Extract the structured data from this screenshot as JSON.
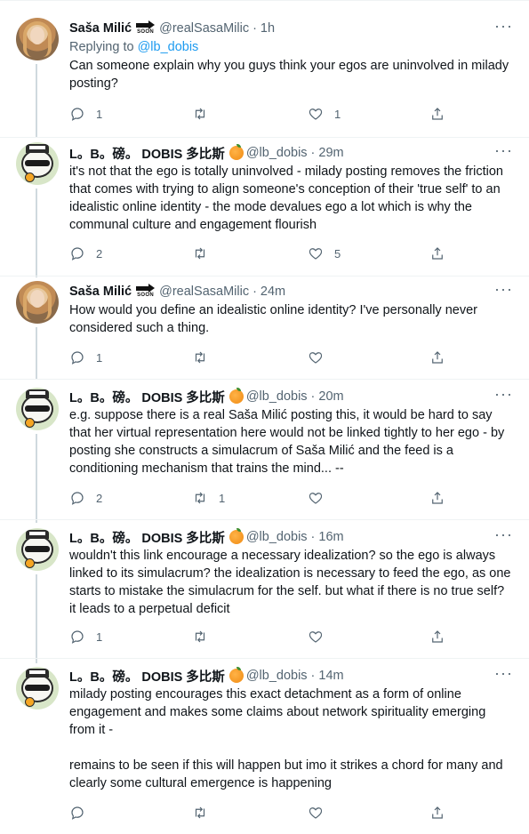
{
  "tweets": [
    {
      "name": "Saša Milić",
      "handle": "@realSasaMilic",
      "time": "1h",
      "badge": "SOON",
      "replying_prefix": "Replying to ",
      "replying_to": "@lb_dobis",
      "text": "Can someone explain why you guys think your egos are uninvolved in milady posting?",
      "replies": "1",
      "retweets": "",
      "likes": "1"
    },
    {
      "name": "L。B。磅。 DOBIS 多比斯",
      "handle": "@lb_dobis",
      "time": "29m",
      "text": "it's not that the ego is totally uninvolved - milady posting removes the friction that comes with trying to align someone's conception of their 'true self' to an idealistic online identity - the mode devalues ego a lot which is why the communal culture and engagement flourish",
      "replies": "2",
      "retweets": "",
      "likes": "5"
    },
    {
      "name": "Saša Milić",
      "handle": "@realSasaMilic",
      "time": "24m",
      "badge": "SOON",
      "text": "How would you define an idealistic online identity? I've personally never considered such a thing.",
      "replies": "1",
      "retweets": "",
      "likes": ""
    },
    {
      "name": "L。B。磅。 DOBIS 多比斯",
      "handle": "@lb_dobis",
      "time": "20m",
      "text": "e.g. suppose there is a real Saša Milić posting this, it would be hard to say that her virtual representation here would not be linked tightly to her ego - by posting she constructs a simulacrum of Saša Milić and the feed is a conditioning mechanism that trains the mind... --",
      "replies": "2",
      "retweets": "1",
      "likes": ""
    },
    {
      "name": "L。B。磅。 DOBIS 多比斯",
      "handle": "@lb_dobis",
      "time": "16m",
      "text": "wouldn't this link encourage a necessary idealization? so the ego is always linked to its simulacrum? the idealization is necessary to feed the ego, as one starts to mistake the simulacrum for the self. but what if there is no true self? it leads to a perpetual deficit",
      "replies": "1",
      "retweets": "",
      "likes": ""
    },
    {
      "name": "L。B。磅。 DOBIS 多比斯",
      "handle": "@lb_dobis",
      "time": "14m",
      "text": "milady posting encourages this exact detachment as a form of online engagement and makes some claims about network spirituality emerging from it -\n\nremains to be seen if this will happen but imo it strikes a chord for many and clearly some cultural emergence is happening",
      "replies": "",
      "retweets": "",
      "likes": ""
    }
  ],
  "icons": {
    "reply": "reply-icon",
    "retweet": "retweet-icon",
    "like": "heart-icon",
    "share": "share-icon",
    "more": "more-icon",
    "orange": "orange-emoji-icon",
    "badge": "soon-arrow-icon"
  },
  "colors": {
    "accent": "#1d9bf0",
    "secondary_text": "#536471",
    "thread_line": "#cfd9de",
    "separator": "#eff3f4"
  },
  "more_glyph": "···",
  "dot_separator": "·"
}
